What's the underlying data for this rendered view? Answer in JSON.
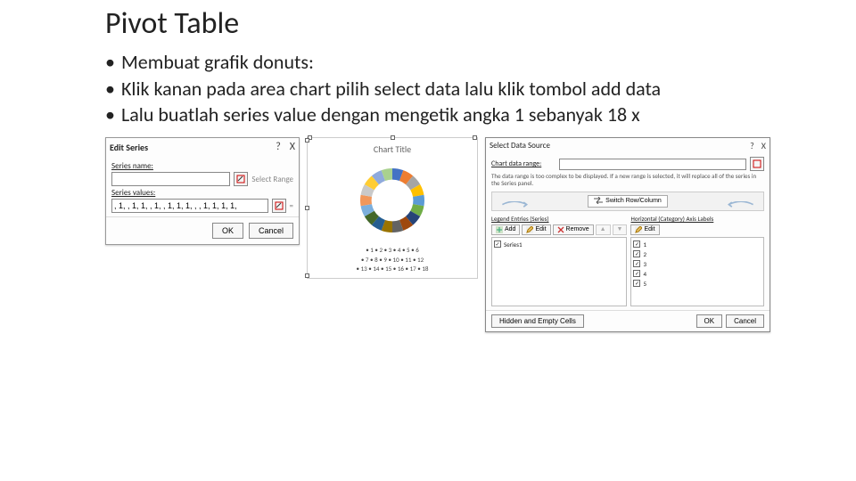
{
  "title": "Pivot Table",
  "bullets": [
    "Membuat grafik donuts:",
    "Klik kanan pada area chart pilih select data lalu klik tombol add data",
    "Lalu buatlah series value dengan mengetik angka 1 sebanyak 18 x"
  ],
  "edit_series": {
    "title": "Edit Series",
    "name_label": "Series name:",
    "name_value": "",
    "name_hint": "Select Range",
    "values_label": "Series values:",
    "values_value": ", 1, , 1, 1, , 1, , 1, 1, 1, , , 1, 1, 1, 1,",
    "values_hint": "=",
    "ok": "OK",
    "cancel": "Cancel"
  },
  "chart_preview": {
    "title": "Chart Title",
    "legend_lines": [
      "• 1  • 2  • 3  • 4  • 5  • 6",
      "• 7  • 8  • 9  • 10 • 11 • 12",
      "• 13 • 14 • 15 • 16 • 17 • 18"
    ]
  },
  "chart_data": {
    "type": "pie",
    "categories": [
      "1",
      "2",
      "3",
      "4",
      "5",
      "6",
      "7",
      "8",
      "9",
      "10",
      "11",
      "12",
      "13",
      "14",
      "15",
      "16",
      "17",
      "18"
    ],
    "values": [
      1,
      1,
      1,
      1,
      1,
      1,
      1,
      1,
      1,
      1,
      1,
      1,
      1,
      1,
      1,
      1,
      1,
      1
    ],
    "title": "Chart Title",
    "colors": [
      "#4472c4",
      "#ed7d31",
      "#a5a5a5",
      "#ffc000",
      "#5b9bd5",
      "#70ad47",
      "#264478",
      "#9e480e",
      "#636363",
      "#997300",
      "#255e91",
      "#43682b",
      "#7cafdd",
      "#f1975a",
      "#c9c9c9",
      "#ffcd33",
      "#8faadc",
      "#a9d18e"
    ]
  },
  "select_data": {
    "title": "Select Data Source",
    "range_label": "Chart data range:",
    "range_value": "",
    "note": "The data range is too complex to be displayed. If a new range is selected, it will replace all of the series in the Series panel.",
    "switch_label": "Switch Row/Column",
    "legend_header": "Legend Entries (Series)",
    "axis_header": "Horizontal (Category) Axis Labels",
    "add": "Add",
    "edit": "Edit",
    "remove": "Remove",
    "edit2": "Edit",
    "series": [
      "Series1"
    ],
    "categories": [
      "1",
      "2",
      "3",
      "4",
      "5"
    ],
    "hidden": "Hidden and Empty Cells",
    "ok": "OK",
    "cancel": "Cancel"
  }
}
